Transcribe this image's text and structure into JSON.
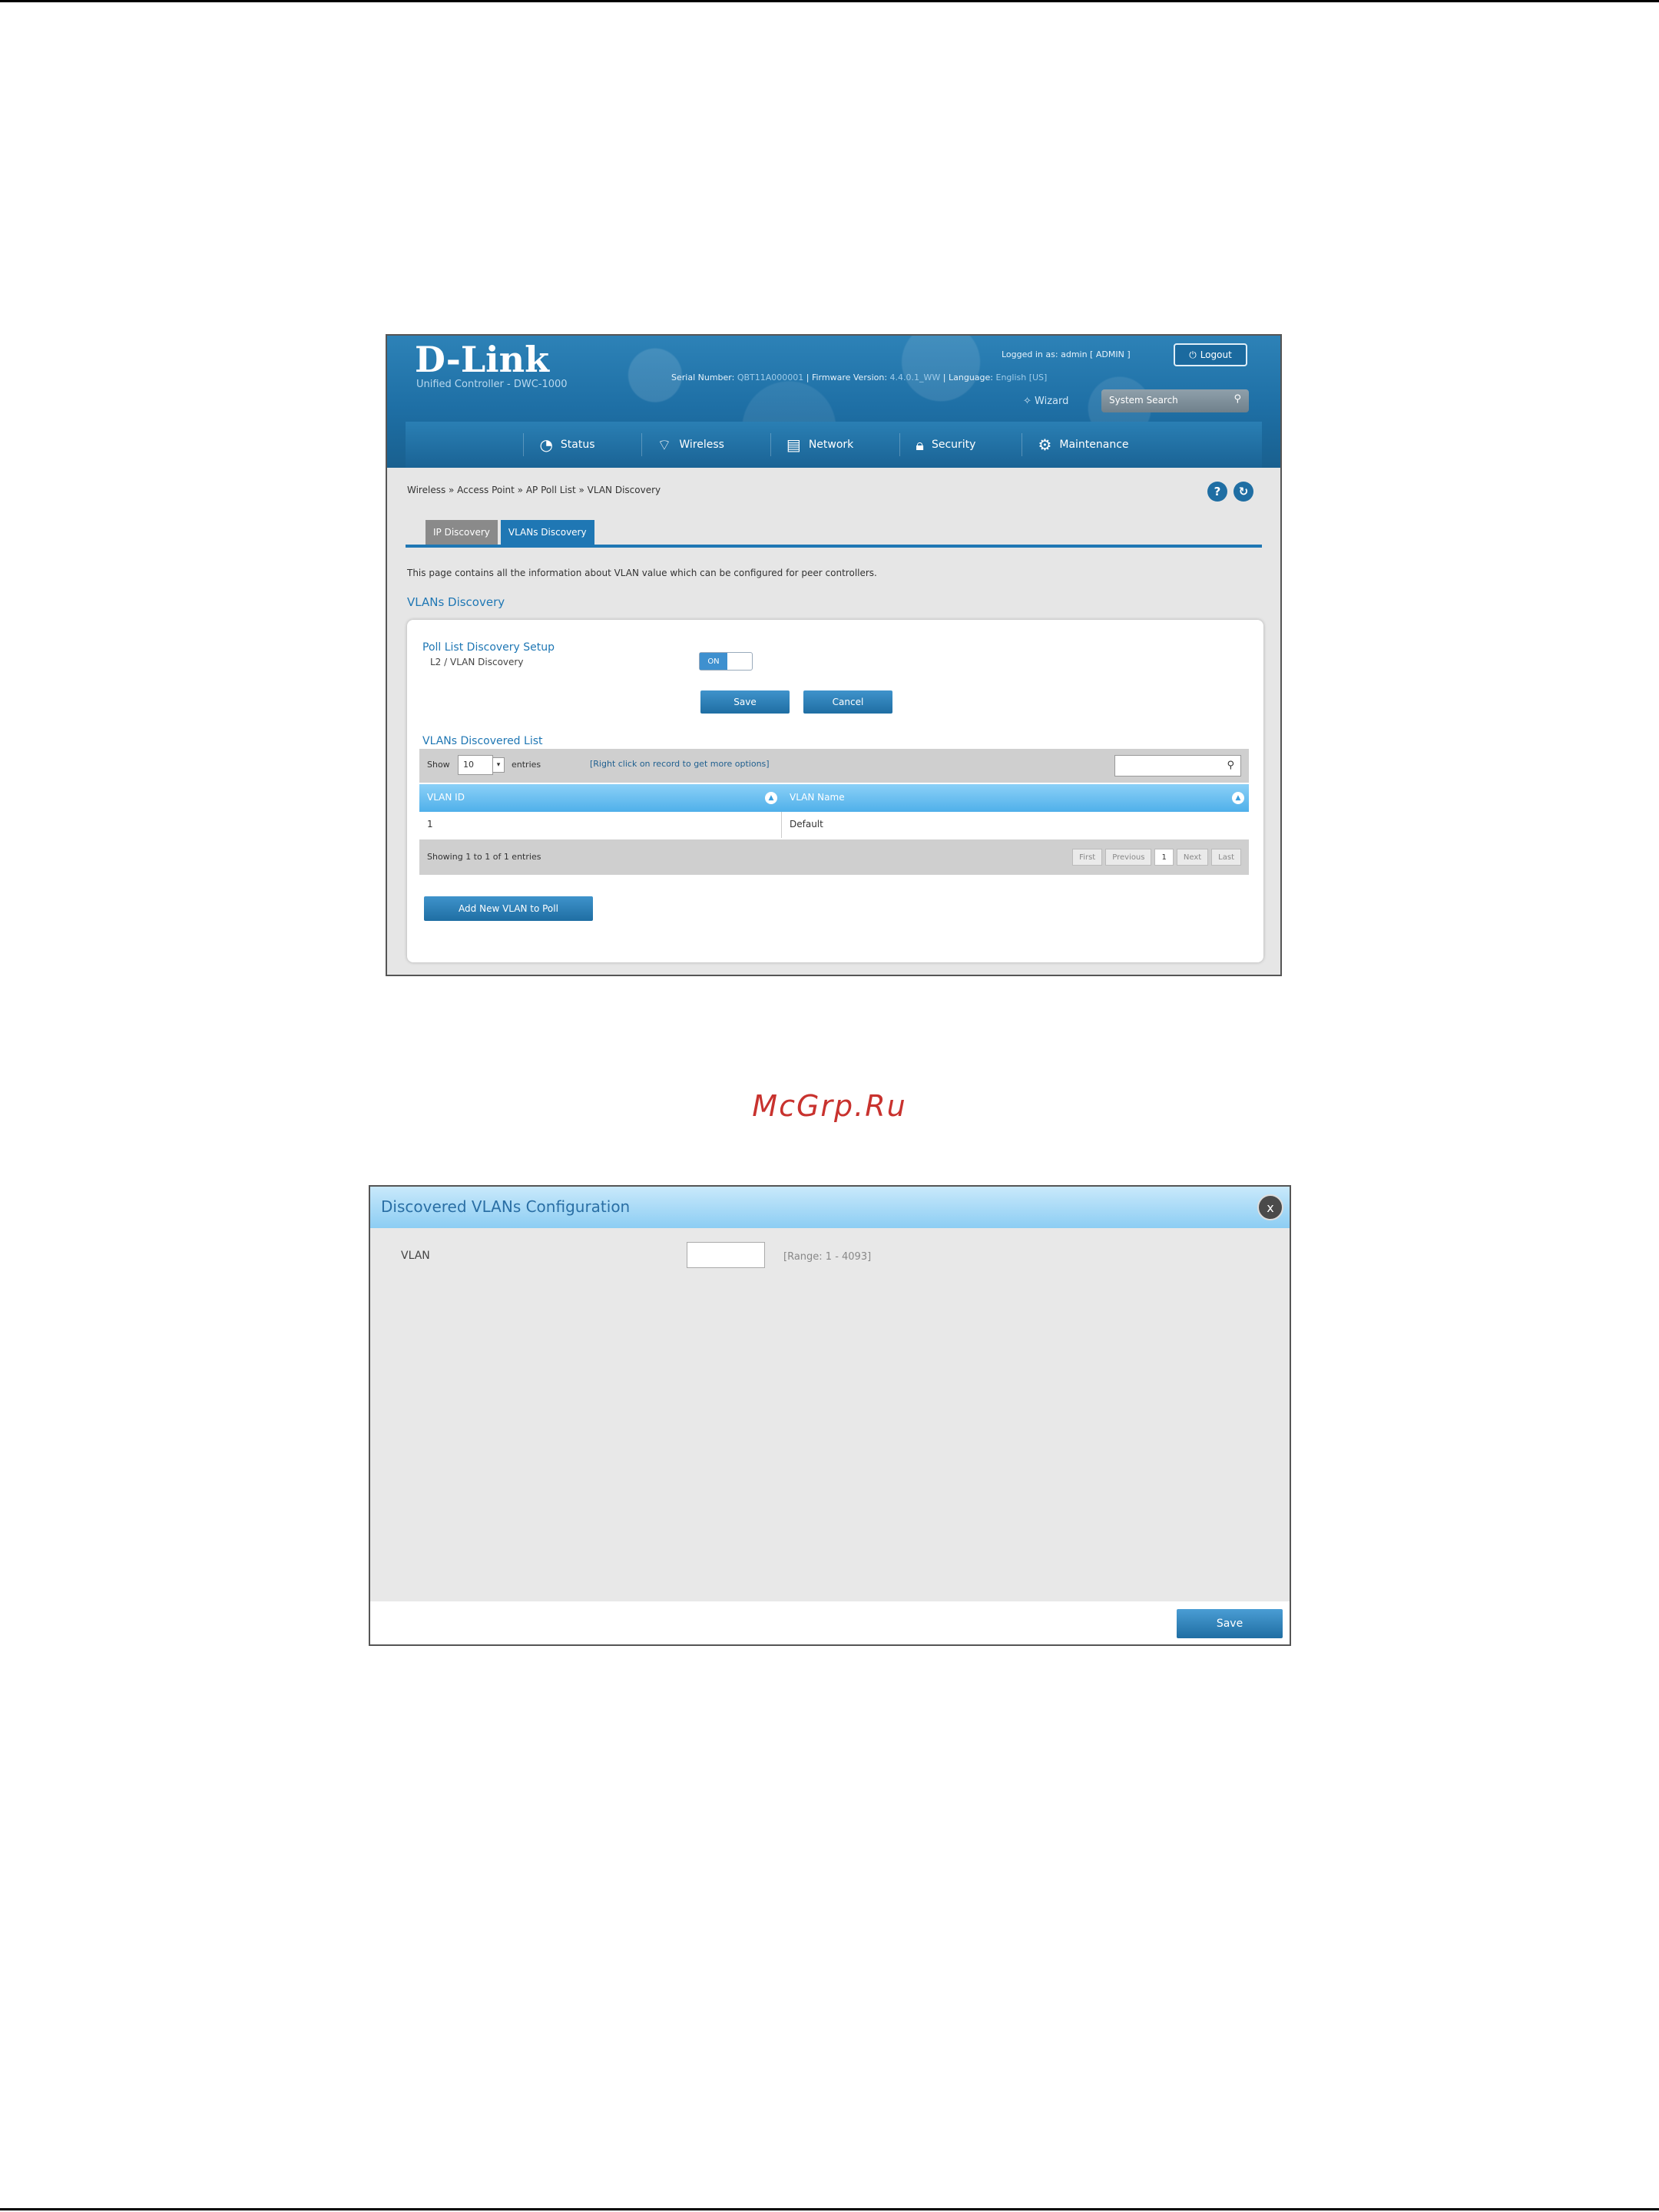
{
  "header": {
    "logo": "D-Link",
    "subtitle": "Unified Controller - DWC-1000",
    "serial_label": "Serial Number:",
    "serial_value": "QBT11A000001",
    "firmware_label": "Firmware Version:",
    "firmware_value": "4.4.0.1_WW",
    "language_label": "Language:",
    "language_value": "English [US]",
    "logged_in_label": "Logged in as:",
    "logged_in_user": "admin",
    "logged_in_role": "ADMIN",
    "logout_label": "Logout",
    "wizard_label": "Wizard",
    "system_search_label": "System Search"
  },
  "nav": {
    "items": [
      {
        "label": "Status",
        "icon": "gauge-icon"
      },
      {
        "label": "Wireless",
        "icon": "wifi-icon"
      },
      {
        "label": "Network",
        "icon": "network-icon"
      },
      {
        "label": "Security",
        "icon": "lock-icon"
      },
      {
        "label": "Maintenance",
        "icon": "gear-icon"
      }
    ]
  },
  "breadcrumb": "Wireless » Access Point » AP Poll List » VLAN Discovery",
  "tabs": [
    "IP Discovery",
    "VLANs Discovery"
  ],
  "description": "This page contains all the information about VLAN value which can be configured for peer controllers.",
  "section_title": "VLANs Discovery",
  "panel": {
    "setup_title": "Poll List Discovery Setup",
    "l2_label": "L2 / VLAN Discovery",
    "toggle_on": "ON",
    "save_label": "Save",
    "cancel_label": "Cancel",
    "list_title": "VLANs Discovered List",
    "show_label": "Show",
    "show_value": "10",
    "entries_label": "entries",
    "hint": "[Right click on record to get more options]",
    "columns": [
      "VLAN ID",
      "VLAN Name"
    ],
    "rows": [
      [
        "1",
        "Default"
      ]
    ],
    "showing": "Showing 1 to 1 of 1 entries",
    "pager": [
      "First",
      "Previous",
      "1",
      "Next",
      "Last"
    ],
    "add_label": "Add New VLAN to Poll"
  },
  "watermark": "McGrp.Ru",
  "dialog": {
    "title": "Discovered VLANs Configuration",
    "close_label": "x",
    "vlan_label": "VLAN",
    "range": "[Range: 1 - 4093]",
    "save_label": "Save"
  }
}
